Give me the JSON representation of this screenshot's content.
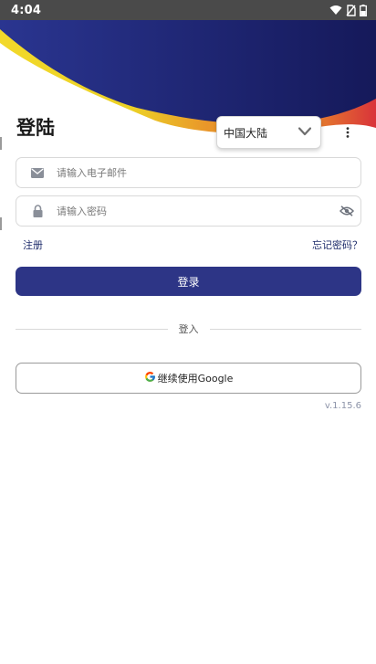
{
  "status_bar": {
    "time": "4:04",
    "icons": [
      "wifi-icon",
      "no-sim-icon",
      "battery-icon"
    ]
  },
  "header": {
    "title": "登陆",
    "colors": {
      "navy": "#1c2262",
      "yellow": "#f2d92a",
      "orange": "#e8912a",
      "red": "#d9333a"
    }
  },
  "region": {
    "selected": "中国大陆",
    "menu_icon": "more-vert-icon"
  },
  "form": {
    "email": {
      "value": "",
      "placeholder": "请输入电子邮件",
      "icon": "envelope-icon"
    },
    "password": {
      "value": "",
      "placeholder": "请输入密码",
      "icon": "lock-icon",
      "toggle_icon": "eye-off-icon"
    },
    "register_label": "注册",
    "forgot_label": "忘记密码？",
    "login_label": "登录",
    "divider_label": "登入",
    "google_label": "继续使用Google"
  },
  "version": "v.1.15.6",
  "colors": {
    "primary": "#2d3586",
    "link": "#1f2d6b"
  }
}
